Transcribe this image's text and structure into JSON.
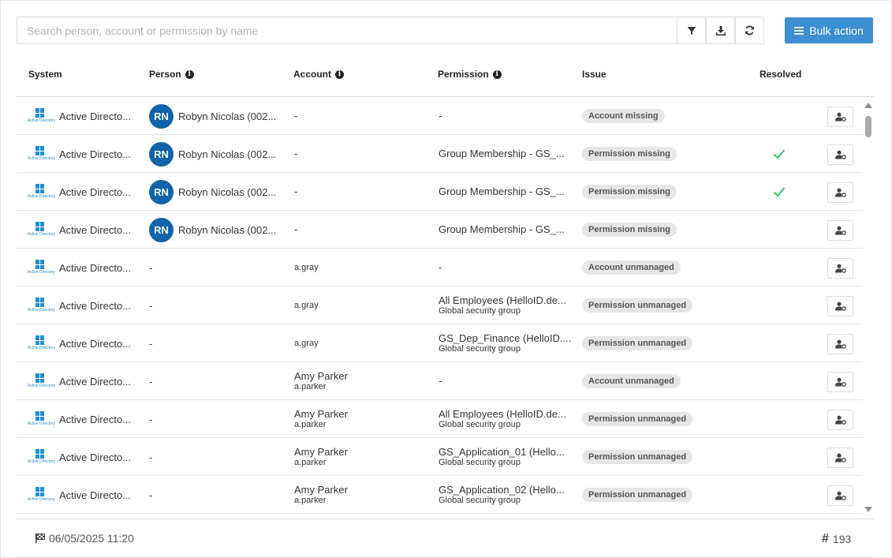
{
  "search": {
    "placeholder": "Search person, account or permission by name"
  },
  "toolbar": {
    "bulk_label": "Bulk action"
  },
  "columns": {
    "system": "System",
    "person": "Person",
    "account": "Account",
    "permission": "Permission",
    "issue": "Issue",
    "resolved": "Resolved"
  },
  "system_caption": "Active Directory",
  "rows": [
    {
      "system": "Active Directo...",
      "avatar": "RN",
      "person": "Robyn Nicolas (002...",
      "account": "-",
      "account_sub": "",
      "permission": "-",
      "permission_sub": "",
      "issue": "Account missing",
      "resolved": false
    },
    {
      "system": "Active Directo...",
      "avatar": "RN",
      "person": "Robyn Nicolas (002...",
      "account": "-",
      "account_sub": "",
      "permission": "Group Membership - GS_...",
      "permission_sub": "",
      "issue": "Permission missing",
      "resolved": true
    },
    {
      "system": "Active Directo...",
      "avatar": "RN",
      "person": "Robyn Nicolas (002...",
      "account": "-",
      "account_sub": "",
      "permission": "Group Membership - GS_...",
      "permission_sub": "",
      "issue": "Permission missing",
      "resolved": true
    },
    {
      "system": "Active Directo...",
      "avatar": "RN",
      "person": "Robyn Nicolas (002...",
      "account": "-",
      "account_sub": "",
      "permission": "Group Membership - GS_...",
      "permission_sub": "",
      "issue": "Permission missing",
      "resolved": false
    },
    {
      "system": "Active Directo...",
      "avatar": "",
      "person": "-",
      "account": "",
      "account_sub": "a.gray",
      "permission": "-",
      "permission_sub": "",
      "issue": "Account unmanaged",
      "resolved": false
    },
    {
      "system": "Active Directo...",
      "avatar": "",
      "person": "-",
      "account": "",
      "account_sub": "a.gray",
      "permission": "All Employees (HelloID.de...",
      "permission_sub": "Global security group",
      "issue": "Permission unmanaged",
      "resolved": false
    },
    {
      "system": "Active Directo...",
      "avatar": "",
      "person": "-",
      "account": "",
      "account_sub": "a.gray",
      "permission": "GS_Dep_Finance (HelloID....",
      "permission_sub": "Global security group",
      "issue": "Permission unmanaged",
      "resolved": false
    },
    {
      "system": "Active Directo...",
      "avatar": "",
      "person": "-",
      "account": "Amy Parker",
      "account_sub": "a.parker",
      "permission": "-",
      "permission_sub": "",
      "issue": "Account unmanaged",
      "resolved": false
    },
    {
      "system": "Active Directo...",
      "avatar": "",
      "person": "-",
      "account": "Amy Parker",
      "account_sub": "a.parker",
      "permission": "All Employees (HelloID.de...",
      "permission_sub": "Global security group",
      "issue": "Permission unmanaged",
      "resolved": false
    },
    {
      "system": "Active Directo...",
      "avatar": "",
      "person": "-",
      "account": "Amy Parker",
      "account_sub": "a.parker",
      "permission": "GS_Application_01 (Hello...",
      "permission_sub": "Global security group",
      "issue": "Permission unmanaged",
      "resolved": false
    },
    {
      "system": "Active Directo...",
      "avatar": "",
      "person": "-",
      "account": "Amy Parker",
      "account_sub": "a.parker",
      "permission": "GS_Application_02 (Hello...",
      "permission_sub": "Global security group",
      "issue": "Permission unmanaged",
      "resolved": false
    }
  ],
  "footer": {
    "timestamp": "06/05/2025 11:20",
    "count": "193"
  },
  "colors": {
    "accent": "#3d8fd3",
    "avatar": "#0f63a8",
    "check": "#2ecc71",
    "badge": "#e6e6e6"
  },
  "icons": [
    "filter-icon",
    "download-icon",
    "refresh-icon",
    "menu-icon",
    "info-icon",
    "windows-icon",
    "check-icon",
    "user-settings-icon",
    "flag-icon",
    "hash-icon"
  ]
}
